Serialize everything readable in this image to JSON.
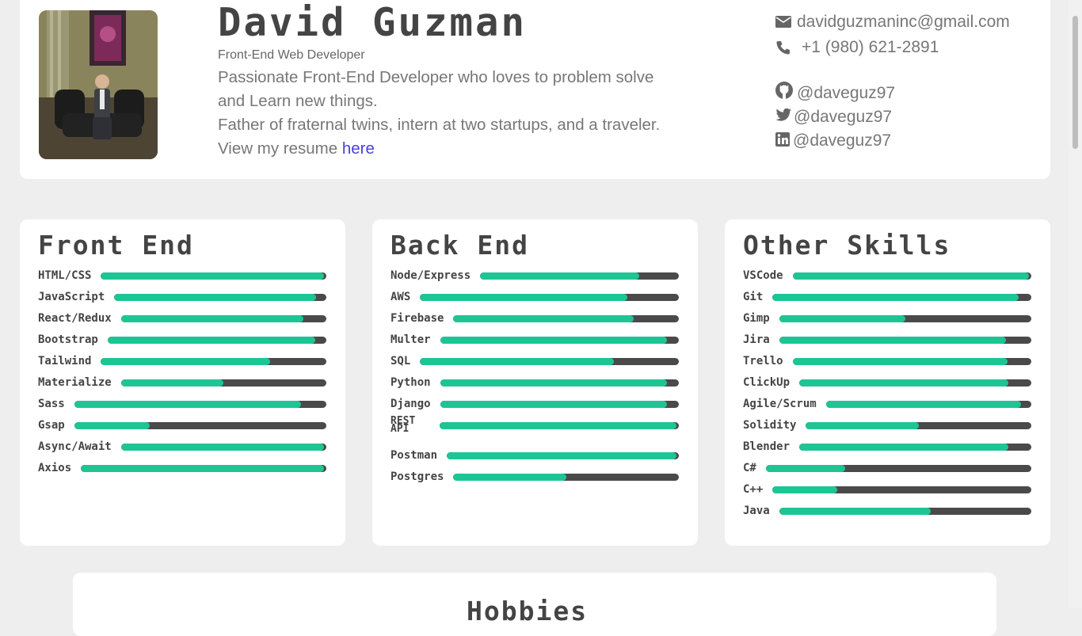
{
  "header": {
    "name": "David Guzman",
    "role": "Front-End Web Developer",
    "bio_line1": "Passionate Front-End Developer who loves to problem solve",
    "bio_line2": "and Learn new things.",
    "bio_line3": "Father of fraternal twins, intern at two startups, and a traveler.",
    "resume_prefix": "View my resume",
    "resume_link": "here",
    "avatar_icon": "person-photo"
  },
  "contact": {
    "email": "davidguzmaninc@gmail.com",
    "phone": "+1 (980) 621-2891",
    "github": "@daveguz97",
    "twitter": "@daveguz97",
    "linkedin": "@daveguz97"
  },
  "colors": {
    "accent": "#1ec594",
    "track": "#4a4a4a",
    "link": "#4a3fd6",
    "background": "#eeeeee"
  },
  "skills": {
    "front_end": {
      "title": "Front End",
      "items": [
        {
          "name": "HTML/CSS",
          "level": 0.99
        },
        {
          "name": "JavaScript",
          "level": 0.95
        },
        {
          "name": "React/Redux",
          "level": 0.89
        },
        {
          "name": "Bootstrap",
          "level": 0.95
        },
        {
          "name": "Tailwind",
          "level": 0.75
        },
        {
          "name": "Materialize",
          "level": 0.5
        },
        {
          "name": "Sass",
          "level": 0.9
        },
        {
          "name": "Gsap",
          "level": 0.3
        },
        {
          "name": "Async/Await",
          "level": 0.99
        },
        {
          "name": "Axios",
          "level": 0.99
        }
      ]
    },
    "back_end": {
      "title": "Back End",
      "items": [
        {
          "name": "Node/Express",
          "level": 0.8
        },
        {
          "name": "AWS",
          "level": 0.8
        },
        {
          "name": "Firebase",
          "level": 0.8
        },
        {
          "name": "Multer",
          "level": 0.95
        },
        {
          "name": "SQL",
          "level": 0.75
        },
        {
          "name": "Python",
          "level": 0.95
        },
        {
          "name": "Django",
          "level": 0.95
        },
        {
          "name": "REST API",
          "level": 0.99
        },
        {
          "name": "Postman",
          "level": 0.99
        },
        {
          "name": "Postgres",
          "level": 0.5
        }
      ]
    },
    "other": {
      "title": "Other Skills",
      "items": [
        {
          "name": "VSCode",
          "level": 0.99
        },
        {
          "name": "Git",
          "level": 0.95
        },
        {
          "name": "Gimp",
          "level": 0.5
        },
        {
          "name": "Jira",
          "level": 0.9
        },
        {
          "name": "Trello",
          "level": 0.9
        },
        {
          "name": "ClickUp",
          "level": 0.9
        },
        {
          "name": "Agile/Scrum",
          "level": 0.95
        },
        {
          "name": "Solidity",
          "level": 0.5
        },
        {
          "name": "Blender",
          "level": 0.9
        },
        {
          "name": "C#",
          "level": 0.3
        },
        {
          "name": "C++",
          "level": 0.25
        },
        {
          "name": "Java",
          "level": 0.6
        }
      ]
    }
  },
  "hobbies": {
    "title": "Hobbies"
  }
}
